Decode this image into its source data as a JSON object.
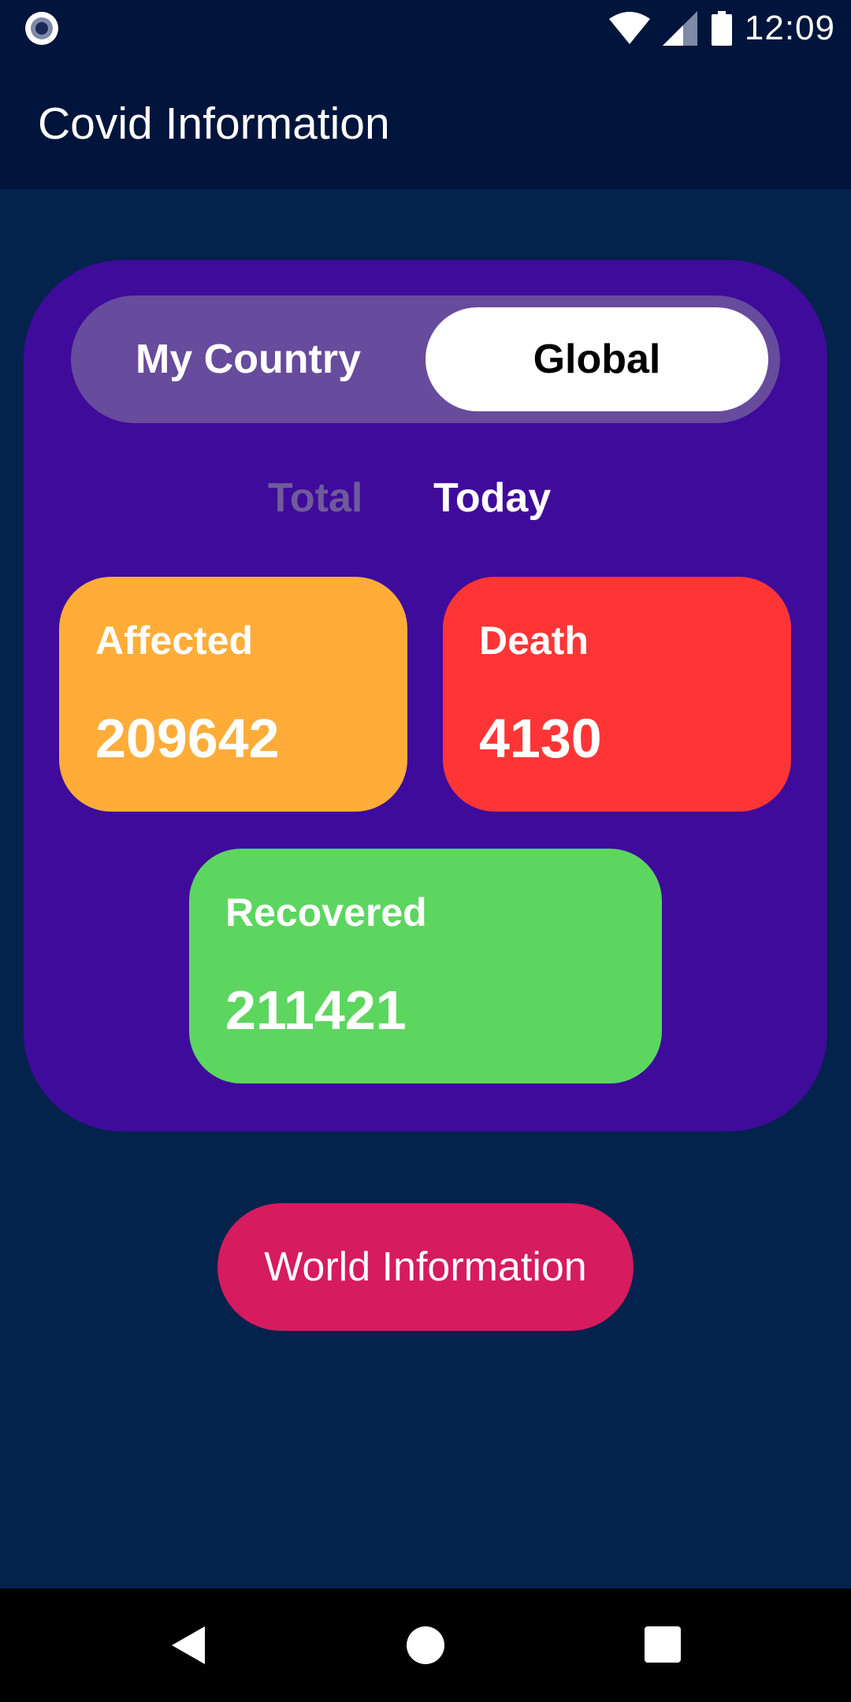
{
  "status_bar": {
    "time": "12:09",
    "icons": [
      "record-icon",
      "wifi-icon",
      "signal-icon",
      "battery-icon"
    ]
  },
  "app_bar": {
    "title": "Covid Information"
  },
  "region_toggle": {
    "options": [
      "My Country",
      "Global"
    ],
    "selected": "Global"
  },
  "period_tabs": {
    "options": [
      "Total",
      "Today"
    ],
    "selected": "Today"
  },
  "stats": [
    {
      "label": "Affected",
      "value": "209642",
      "color": "#ffac38"
    },
    {
      "label": "Death",
      "value": "4130",
      "color": "#ff3535"
    },
    {
      "label": "Recovered",
      "value": "211421",
      "color": "#5cd65f"
    }
  ],
  "world_button": {
    "label": "World Information",
    "color": "#d61b5f"
  },
  "nav_bar": {
    "icons": [
      "back-icon",
      "home-icon",
      "recents-icon"
    ]
  },
  "colors": {
    "background": "#03224c",
    "app_bar": "#01143b",
    "card": "#3f0b9b",
    "toggle_track": "#674b9d"
  }
}
